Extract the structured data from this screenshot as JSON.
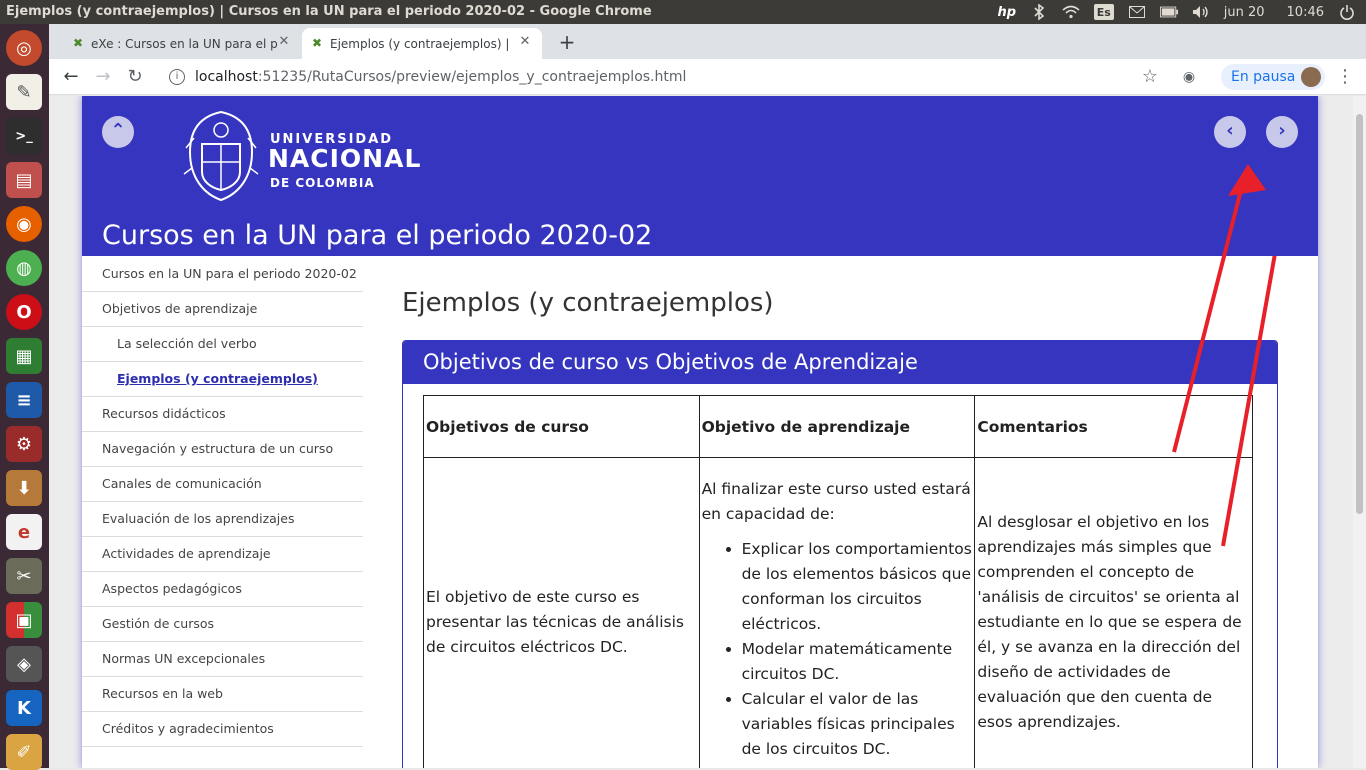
{
  "system": {
    "window_title": "Ejemplos (y contraejemplos) | Cursos en la UN para el periodo 2020-02 - Google Chrome",
    "lang": "Es",
    "date": "jun 20",
    "time": "10:46"
  },
  "browser": {
    "tabs": [
      {
        "label": "eXe : Cursos en la UN para el p"
      },
      {
        "label": "Ejemplos (y contraejemplos) |"
      }
    ],
    "url_host": "localhost",
    "url_path": ":51235/RutaCursos/preview/ejemplos_y_contraejemplos.html",
    "profile_label": "En pausa"
  },
  "header": {
    "logo_line1": "UNIVERSIDAD",
    "logo_line2": "NACIONAL",
    "logo_line3": "DE COLOMBIA",
    "site_title": "Cursos en la UN para el periodo 2020-02"
  },
  "sidebar": {
    "items": [
      {
        "label": "Cursos en la UN para el periodo 2020-02"
      },
      {
        "label": "Objetivos de aprendizaje"
      },
      {
        "label": "La selección del verbo"
      },
      {
        "label": "Ejemplos (y contraejemplos)"
      },
      {
        "label": "Recursos didácticos"
      },
      {
        "label": "Navegación y estructura de un curso"
      },
      {
        "label": "Canales de comunicación"
      },
      {
        "label": "Evaluación de los aprendizajes"
      },
      {
        "label": "Actividades de aprendizaje"
      },
      {
        "label": "Aspectos pedagógicos"
      },
      {
        "label": "Gestión de cursos"
      },
      {
        "label": "Normas UN excepcionales"
      },
      {
        "label": "Recursos en la web"
      },
      {
        "label": "Créditos y agradecimientos"
      }
    ]
  },
  "main": {
    "heading": "Ejemplos (y contraejemplos)",
    "box_title": "Objetivos de curso vs Objetivos de Aprendizaje",
    "table": {
      "headers": [
        "Objetivos de curso",
        "Objetivo de aprendizaje",
        "Comentarios"
      ],
      "course_objective": "El objetivo de este curso es presentar las técnicas de análisis de circuitos eléctricos DC.",
      "learning_intro": "Al finalizar este curso usted estará en capacidad de:",
      "learning_items": [
        "Explicar los comportamientos de los elementos básicos que conforman los circuitos eléctricos.",
        "Modelar matemáticamente circuitos DC.",
        "Calcular el valor de las variables físicas principales de los circuitos DC."
      ],
      "comment": "Al desglosar el objetivo en los aprendizajes más simples que comprenden el concepto de 'análisis de circuitos' se orienta al estudiante en lo que se espera de él, y se avanza en la dirección del diseño de actividades de evaluación que den cuenta de esos aprendizajes."
    }
  },
  "colors": {
    "brand": "#3535bf",
    "annotation_arrow": "#e8202a"
  }
}
